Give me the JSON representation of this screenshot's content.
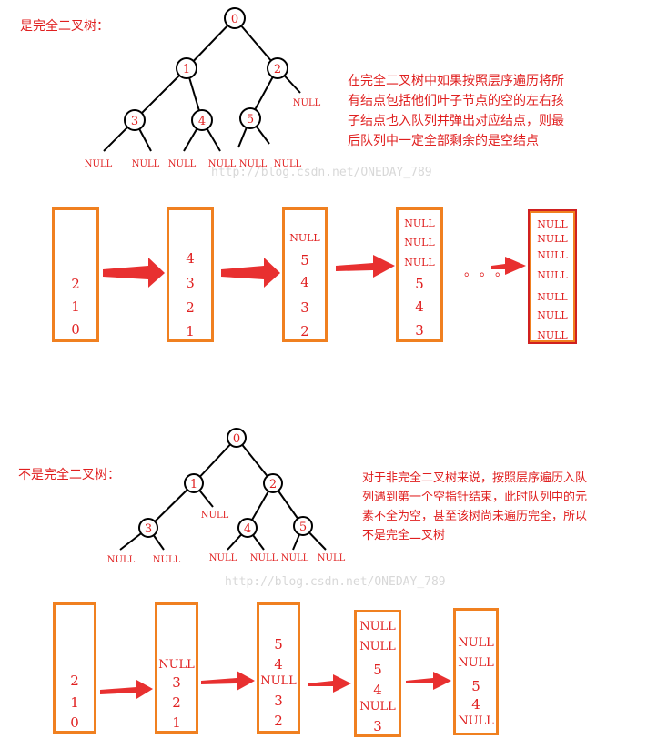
{
  "section1": {
    "label": "是完全二叉树：",
    "description": [
      "在完全二叉树中如果按照层序遍历将所",
      "有结点包括他们叶子节点的空的左右孩",
      "子结点也入队列并弹出对应结点，则最",
      "后队列中一定全部剩余的是空结点"
    ],
    "watermark": "http://blog.csdn.net/ONEDAY_789",
    "tree": {
      "nodes": [
        "0",
        "1",
        "2",
        "3",
        "4",
        "5"
      ],
      "null_label": "NULL"
    },
    "queues": [
      [
        "2",
        "1",
        "0"
      ],
      [
        "4",
        "3",
        "2",
        "1"
      ],
      [
        "NULL",
        "5",
        "4",
        "3",
        "2"
      ],
      [
        "NULL",
        "NULL",
        "NULL",
        "5",
        "4",
        "3"
      ],
      [
        "NULL",
        "NULL",
        "NULL",
        "NULL",
        "NULL",
        "NULL",
        "NULL"
      ]
    ],
    "dots": "。。。"
  },
  "section2": {
    "label": "不是完全二叉树：",
    "description": [
      "对于非完全二叉树来说，按照层序遍历入队",
      "列遇到第一个空指针结束，此时队列中的元",
      "素不全为空，甚至该树尚未遍历完全，所以",
      "不是完全二叉树"
    ],
    "watermark": "http://blog.csdn.net/ONEDAY_789",
    "tree": {
      "nodes": [
        "0",
        "1",
        "2",
        "3",
        "4",
        "5"
      ],
      "null_label": "NULL"
    },
    "queues": [
      [
        "2",
        "1",
        "0"
      ],
      [
        "NULL",
        "3",
        "2",
        "1"
      ],
      [
        "5",
        "4",
        "NULL",
        "3",
        "2"
      ],
      [
        "NULL",
        "NULL",
        "5",
        "4",
        "NULL",
        "3"
      ],
      [
        "NULL",
        "NULL",
        "5",
        "4",
        "NULL"
      ]
    ]
  },
  "colors": {
    "text": "#e02020",
    "box": "#f08020",
    "arrow": "#e83030"
  }
}
